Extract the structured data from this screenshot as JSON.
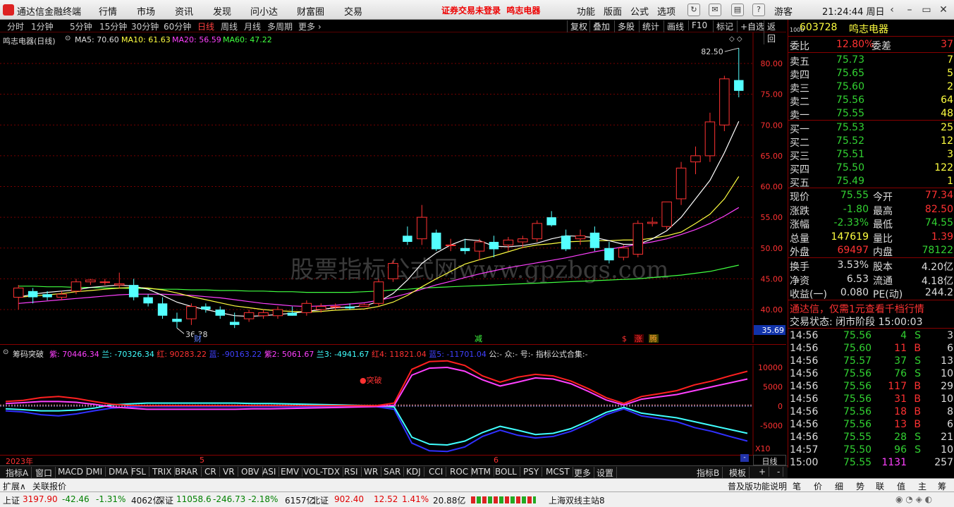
{
  "titlebar": {
    "app_name": "通达信金融终端",
    "menus": [
      "行情",
      "市场",
      "资讯",
      "发现",
      "问小达",
      "财富圈",
      "交易"
    ],
    "warning": "证券交易未登录",
    "stock_name": "鸣志电器",
    "right_menus": [
      "功能",
      "版面",
      "公式",
      "选项"
    ],
    "guest": "游客",
    "time": "21:24:44 周日"
  },
  "periodbar": {
    "periods": [
      "分时",
      "1分钟",
      "5分钟",
      "15分钟",
      "30分钟",
      "60分钟",
      "日线",
      "周线",
      "月线",
      "多周期",
      "更多 ›"
    ],
    "active": "日线",
    "right_buttons": [
      "复权",
      "叠加",
      "多股",
      "统计",
      "画线",
      "F10",
      "标记",
      "+自选",
      "返回"
    ]
  },
  "main_chart": {
    "title": "鸣志电器(日线)",
    "ma5": "MA5: 70.60",
    "ma10": "MA10: 61.63",
    "ma20": "MA20: 56.59",
    "ma60": "MA60: 47.22",
    "price_labels": [
      "80.00",
      "75.00",
      "70.00",
      "65.00",
      "60.00",
      "55.00",
      "50.00",
      "45.00",
      "40.00"
    ],
    "high_mark": "82.50",
    "low_mark": "36.38",
    "cursor_price": "35.69",
    "markers": {
      "cai": "财",
      "jian": "减",
      "dollar": "$",
      "zhang": "涨",
      "teng": "腾"
    },
    "watermark": "股票指标公式网www.gpzbgs.com"
  },
  "chart_data": {
    "type": "candlestick",
    "candles": [
      [
        42,
        44,
        40,
        43.5
      ],
      [
        43,
        43.5,
        41,
        42
      ],
      [
        42.5,
        43,
        41.5,
        42
      ],
      [
        42,
        43,
        41.5,
        42.5
      ],
      [
        43,
        45,
        42.5,
        44.5
      ],
      [
        44.5,
        45,
        44,
        44.8
      ],
      [
        44.5,
        45,
        44,
        44.5
      ],
      [
        44,
        46,
        43.5,
        44.2
      ],
      [
        44,
        45,
        41.5,
        42
      ],
      [
        42,
        42.5,
        40.5,
        41
      ],
      [
        41,
        42,
        38.5,
        39
      ],
      [
        38.5,
        39.5,
        37,
        38
      ],
      [
        38.5,
        41,
        37.5,
        40.5
      ],
      [
        40.5,
        41,
        39.5,
        40
      ],
      [
        40,
        40.5,
        38.5,
        39
      ],
      [
        38,
        39.5,
        37,
        37.5
      ],
      [
        38.5,
        40,
        38,
        39.5
      ],
      [
        39,
        40,
        38.5,
        39.5
      ],
      [
        39,
        40.5,
        38.5,
        40
      ],
      [
        39.5,
        40.5,
        39,
        39
      ],
      [
        39.5,
        41.5,
        39,
        41
      ],
      [
        40,
        41,
        39.5,
        40.5
      ],
      [
        40.5,
        41,
        40,
        40.5
      ],
      [
        40.5,
        41,
        40,
        40.2
      ],
      [
        40.5,
        41,
        40.5,
        40.8
      ],
      [
        41,
        45,
        40.5,
        44.5
      ],
      [
        45,
        48,
        44.5,
        47.5
      ],
      [
        52,
        53.5,
        50.5,
        51
      ],
      [
        51.5,
        57,
        50.5,
        55
      ],
      [
        52.5,
        53,
        49.5,
        49.8
      ],
      [
        50.5,
        51.5,
        49.5,
        50.5
      ],
      [
        50,
        51.5,
        49,
        49.5
      ],
      [
        49.5,
        51.5,
        48,
        51
      ],
      [
        51,
        52,
        48.5,
        49.8
      ],
      [
        50.5,
        51.8,
        49.5,
        51.3
      ],
      [
        51,
        52,
        50,
        51.5
      ],
      [
        51.5,
        54.5,
        51,
        54
      ],
      [
        55,
        56,
        53.5,
        53.7
      ],
      [
        52,
        53,
        49.5,
        49.8
      ],
      [
        51.5,
        53,
        50.5,
        52
      ],
      [
        52.5,
        53.5,
        49.5,
        50
      ],
      [
        50,
        51,
        47.5,
        48
      ],
      [
        48.5,
        50.5,
        48,
        50
      ],
      [
        49,
        54.5,
        48.5,
        54
      ],
      [
        54,
        55,
        53.5,
        54.2
      ],
      [
        53.5,
        57.5,
        53,
        57.5
      ],
      [
        58,
        64,
        57,
        63
      ],
      [
        64,
        66.5,
        62,
        65
      ],
      [
        65,
        72,
        64,
        70.5
      ],
      [
        70,
        78,
        69,
        77.5
      ],
      [
        77.3,
        82.5,
        74.5,
        75.55
      ]
    ],
    "ma5": [
      42,
      42.5,
      42.8,
      43,
      43.2,
      43.6,
      43.8,
      44,
      43.8,
      43.3,
      42.3,
      41.2,
      40.5,
      40,
      39.5,
      39,
      38.9,
      39,
      39.2,
      39.4,
      39.7,
      40,
      40.3,
      40.4,
      40.6,
      41.3,
      42.6,
      44.8,
      47.5,
      49.2,
      50.5,
      51.4,
      51.2,
      50.3,
      50.2,
      50.4,
      50.8,
      51.5,
      52,
      51.9,
      51.7,
      51.2,
      50.6,
      50.6,
      51.5,
      52.8,
      55,
      58,
      61,
      65.5,
      70.6
    ],
    "ma10": [
      42,
      42.2,
      42.4,
      42.6,
      42.9,
      43.1,
      43.3,
      43.5,
      43.6,
      43.5,
      43.2,
      42.7,
      42.1,
      41.6,
      41.1,
      40.6,
      40.3,
      40,
      39.8,
      39.7,
      39.6,
      39.7,
      39.9,
      40,
      40.1,
      40.5,
      41.2,
      42.3,
      43.7,
      45,
      46.2,
      47.4,
      48.1,
      48.7,
      49.4,
      50.1,
      50.5,
      50.7,
      51,
      51.1,
      51.2,
      51.2,
      51.3,
      51.3,
      51.6,
      52,
      52.6,
      54,
      55.5,
      58,
      61.63
    ],
    "ma20": [
      41,
      41.2,
      41.4,
      41.6,
      41.8,
      42,
      42.2,
      42.4,
      42.5,
      42.5,
      42.5,
      42.4,
      42.3,
      42.1,
      41.9,
      41.6,
      41.3,
      41,
      40.8,
      40.6,
      40.5,
      40.6,
      40.7,
      40.9,
      41.1,
      41.5,
      42,
      42.6,
      43.3,
      44,
      44.6,
      45.2,
      45.8,
      46.3,
      46.8,
      47.2,
      47.6,
      48,
      48.4,
      48.9,
      49.4,
      49.8,
      50.2,
      50.6,
      51,
      51.5,
      52.2,
      53,
      54,
      55.2,
      56.59
    ],
    "ma60": [
      43.8,
      43.8,
      43.7,
      43.7,
      43.6,
      43.6,
      43.5,
      43.5,
      43.4,
      43.4,
      43.3,
      43.3,
      43.2,
      43.2,
      43.1,
      43.1,
      43,
      43,
      42.9,
      42.9,
      42.8,
      42.8,
      42.8,
      42.8,
      42.9,
      43,
      43.2,
      43.3,
      43.5,
      43.6,
      43.7,
      43.8,
      43.9,
      44,
      44.1,
      44.2,
      44.3,
      44.4,
      44.5,
      44.6,
      44.7,
      44.8,
      44.9,
      45,
      45.2,
      45.4,
      45.6,
      45.9,
      46.2,
      46.7,
      47.22
    ],
    "ylim": [
      35.69,
      83.5
    ]
  },
  "indicator": {
    "title": "筹码突破",
    "values": [
      {
        "label": "紫: 70446.34",
        "color": "#ff40ff"
      },
      {
        "label": "兰: -70326.34",
        "color": "#40ffff"
      },
      {
        "label": "红: 90283.22",
        "color": "#ff3232"
      },
      {
        "label": "蓝: -90163.22",
        "color": "#4040ff"
      },
      {
        "label": "紫2: 5061.67",
        "color": "#ff40ff"
      },
      {
        "label": "兰3: -4941.67",
        "color": "#40ffff"
      },
      {
        "label": "红4: 11821.04",
        "color": "#ff3232"
      },
      {
        "label": "蓝5: -11701.04",
        "color": "#4040ff"
      },
      {
        "label": "公:- 众:- 号:- 指标公式合集:-",
        "color": "#dddddd"
      }
    ],
    "breakout_label": "突破",
    "axis": [
      "10000",
      "5000",
      "0",
      "-5000"
    ],
    "scale": "X10",
    "red": [
      1200,
      1500,
      2200,
      2500,
      2000,
      1200,
      500,
      200,
      100,
      150,
      150,
      150,
      150,
      150,
      150,
      150,
      150,
      150,
      150,
      150,
      150,
      150,
      800,
      9500,
      11500,
      11700,
      10500,
      7800,
      6200,
      7500,
      8200,
      7800,
      6500,
      4500,
      2200,
      700,
      2500,
      3200,
      4000,
      5500,
      6500,
      7800,
      9000
    ],
    "purple": [
      700,
      900,
      1200,
      1200,
      1000,
      500,
      -200,
      -500,
      -800,
      -800,
      -800,
      -800,
      -800,
      -800,
      -700,
      -700,
      -600,
      -500,
      -400,
      -300,
      -200,
      -100,
      200,
      8000,
      9800,
      10000,
      9000,
      6800,
      5200,
      6200,
      7300,
      7000,
      5800,
      3800,
      1600,
      300,
      1800,
      2400,
      3000,
      4000,
      5000,
      6000,
      7000
    ],
    "cyan": [
      -700,
      -900,
      -1200,
      -1200,
      -1000,
      -500,
      300,
      600,
      800,
      800,
      800,
      800,
      800,
      800,
      700,
      700,
      600,
      500,
      400,
      300,
      200,
      100,
      -200,
      -8000,
      -9800,
      -10000,
      -9000,
      -6800,
      -5200,
      -6200,
      -7300,
      -7000,
      -5800,
      -3800,
      -1600,
      -300,
      -1800,
      -2400,
      -3000,
      -4000,
      -5000,
      -6000,
      -7000
    ],
    "blue": [
      -1200,
      -1500,
      -2200,
      -2500,
      -2000,
      -1200,
      -500,
      -200,
      -100,
      -150,
      -150,
      -150,
      -150,
      -150,
      -150,
      -150,
      -150,
      -150,
      -150,
      -150,
      -150,
      -150,
      -800,
      -9500,
      -11500,
      -11700,
      -10500,
      -7800,
      -6200,
      -7500,
      -8200,
      -7800,
      -6500,
      -4500,
      -2200,
      -700,
      -2500,
      -3200,
      -4000,
      -5500,
      -6500,
      -7800,
      -9000
    ]
  },
  "date_axis": {
    "year": "2023年",
    "m5": "5",
    "m6": "6"
  },
  "right_panel": {
    "code": "603728",
    "name": "鸣志电器",
    "weibi_label": "委比",
    "weibi": "12.80%",
    "weicha_label": "委差",
    "weicha": "37",
    "sells": [
      {
        "label": "卖五",
        "price": "75.73",
        "vol": "7"
      },
      {
        "label": "卖四",
        "price": "75.65",
        "vol": "5"
      },
      {
        "label": "卖三",
        "price": "75.60",
        "vol": "2"
      },
      {
        "label": "卖二",
        "price": "75.56",
        "vol": "64"
      },
      {
        "label": "卖一",
        "price": "75.55",
        "vol": "48"
      }
    ],
    "buys": [
      {
        "label": "买一",
        "price": "75.53",
        "vol": "25"
      },
      {
        "label": "买二",
        "price": "75.52",
        "vol": "12"
      },
      {
        "label": "买三",
        "price": "75.51",
        "vol": "3"
      },
      {
        "label": "买四",
        "price": "75.50",
        "vol": "122"
      },
      {
        "label": "买五",
        "price": "75.49",
        "vol": "1"
      }
    ],
    "quote": [
      {
        "l1": "现价",
        "v1": "75.55",
        "c1": "green",
        "l2": "今开",
        "v2": "77.34",
        "c2": "red"
      },
      {
        "l1": "涨跌",
        "v1": "-1.80",
        "c1": "green",
        "l2": "最高",
        "v2": "82.50",
        "c2": "red"
      },
      {
        "l1": "涨幅",
        "v1": "-2.33%",
        "c1": "green",
        "l2": "最低",
        "v2": "74.55",
        "c2": "green"
      },
      {
        "l1": "总量",
        "v1": "147619",
        "c1": "yellow",
        "l2": "量比",
        "v2": "1.39",
        "c2": "red"
      },
      {
        "l1": "外盘",
        "v1": "69497",
        "c1": "red",
        "l2": "内盘",
        "v2": "78122",
        "c2": "green"
      }
    ],
    "fund": [
      {
        "l1": "换手",
        "v1": "3.53%",
        "l2": "股本",
        "v2": "4.20亿"
      },
      {
        "l1": "净资",
        "v1": "6.53",
        "l2": "流通",
        "v2": "4.18亿"
      },
      {
        "l1": "收益(一)",
        "v1": "0.080",
        "l2": "PE(动)",
        "v2": "244.2"
      }
    ],
    "ad": "通达信，仅需1元查看千档行情",
    "trade_state": "交易状态: 闭市阶段 15:00:03",
    "ticks": [
      {
        "t": "14:56",
        "p": "75.56",
        "v": "4",
        "s": "S",
        "n": "3"
      },
      {
        "t": "14:56",
        "p": "75.60",
        "v": "11",
        "s": "B",
        "n": "6"
      },
      {
        "t": "14:56",
        "p": "75.57",
        "v": "37",
        "s": "S",
        "n": "13"
      },
      {
        "t": "14:56",
        "p": "75.56",
        "v": "76",
        "s": "S",
        "n": "10"
      },
      {
        "t": "14:56",
        "p": "75.56",
        "v": "117",
        "s": "B",
        "n": "29"
      },
      {
        "t": "14:56",
        "p": "75.56",
        "v": "31",
        "s": "B",
        "n": "10"
      },
      {
        "t": "14:56",
        "p": "75.56",
        "v": "18",
        "s": "B",
        "n": "8"
      },
      {
        "t": "14:56",
        "p": "75.56",
        "v": "13",
        "s": "B",
        "n": "6"
      },
      {
        "t": "14:56",
        "p": "75.55",
        "v": "28",
        "s": "S",
        "n": "21"
      },
      {
        "t": "14:57",
        "p": "75.50",
        "v": "96",
        "s": "S",
        "n": "10"
      },
      {
        "t": "15:00",
        "p": "75.55",
        "v": "1131",
        "s": "",
        "n": "257"
      }
    ]
  },
  "indicator_tabs": [
    "指标A",
    "窗口",
    "MACD",
    "DMI",
    "DMA",
    "FSL",
    "TRIX",
    "BRAR",
    "CR",
    "VR",
    "OBV",
    "ASI",
    "EMV",
    "VOL-TDX",
    "RSI",
    "WR",
    "SAR",
    "KDJ",
    "CCI",
    "ROC",
    "MTM",
    "BOLL",
    "PSY",
    "MCST",
    "更多",
    "设置"
  ],
  "indicator_right": [
    "指标B",
    "模板",
    "+",
    "-"
  ],
  "rp_tab": "日线",
  "bottombar": {
    "left": [
      "扩展∧",
      "关联报价"
    ],
    "right": [
      "普及版功能说明",
      "笔",
      "价",
      "细",
      "势",
      "联",
      "值",
      "主",
      "筹"
    ]
  },
  "statusbar": {
    "sh": "上证",
    "sh_val": "3197.90",
    "sh_chg": "-42.46",
    "sh_pct": "-1.31%",
    "sh_amt": "4062亿",
    "sz": "深证",
    "sz_val": "11058.6",
    "sz_chg": "-246.73",
    "sz_pct": "-2.18%",
    "sz_amt": "6157亿",
    "bz": "北证",
    "bz_val": "902.40",
    "bz_chg": "12.52",
    "bz_pct": "1.41%",
    "bz_amt": "20.88亿",
    "server": "上海双线主站8"
  }
}
